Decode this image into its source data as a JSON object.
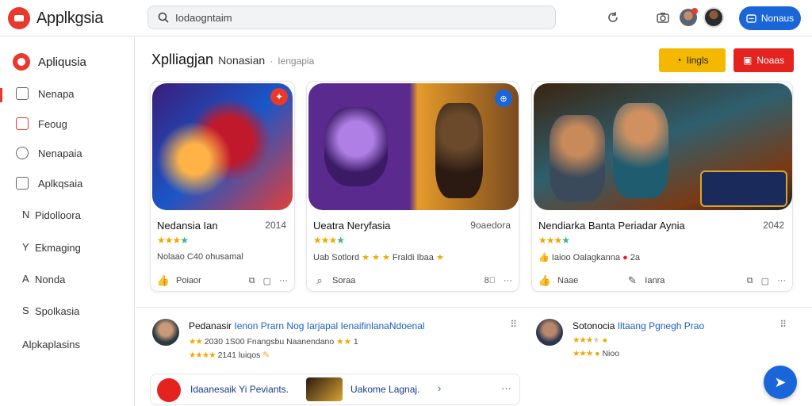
{
  "app": {
    "name": "Applkgsia"
  },
  "search": {
    "value": "Iodaogntaim",
    "icon": "search-icon"
  },
  "top_actions": {
    "signin_label": "Nonaus"
  },
  "sidebar": {
    "header": "Apliqusia",
    "items": [
      {
        "label": "Nenapa",
        "icon": "home-icon"
      },
      {
        "label": "Feoug",
        "icon": "bookmark-icon"
      },
      {
        "label": "Nenapaia",
        "icon": "chat-icon"
      },
      {
        "label": "Aplkqsaia",
        "icon": "grid-icon"
      },
      {
        "label": "Pidolloora",
        "prefix": "N"
      },
      {
        "label": "Ekmaging",
        "prefix": "Y"
      },
      {
        "label": "Nonda",
        "prefix": "A"
      },
      {
        "label": "Spolkasia",
        "prefix": "S"
      },
      {
        "label": "Alpkaplasins",
        "prefix": ""
      }
    ]
  },
  "header": {
    "title": "Xplliagjan",
    "subtitle": "Nonasian",
    "sep": "·",
    "crumb": "Iengapia",
    "btn_yellow": "Iingls",
    "btn_red": "Noaas"
  },
  "cards": [
    {
      "title": "Nedansia Ian",
      "meta": "2014",
      "info": "Nolaao C40 ohusamal",
      "action": "Poiaor"
    },
    {
      "title": "Ueatra Neryfasia",
      "meta": "9oaedora",
      "info": "Uab Sotlord",
      "info_extra": "Fraldi Ibaa",
      "action": "Soraa"
    },
    {
      "title": "Nendiarka Banta Periadar Aynia",
      "meta": "2042",
      "info": "Iaioo Oalagkanna",
      "info_extra": "2a",
      "action": "Naae",
      "action2": "Ianra"
    }
  ],
  "list": [
    {
      "title_a": "Pedanasir",
      "title_b": "Ienon Prarn Nog Iarjapal IenaifinlanaNdoenal",
      "line1": "2030 1S00 Fnangsbu Naanendano",
      "line1_extra": "1",
      "line2": "2141 luiqos"
    },
    {
      "title_a": "Sotonocia",
      "title_b": "Iltaang Pgnegh Prao",
      "line1": "",
      "line2": "Nioo"
    },
    {
      "title_a": "Idaanesaik Yi Peviants.",
      "title_b": "Uakome Lagnaj.",
      "line1": ""
    }
  ],
  "colors": {
    "accent_red": "#e8392c",
    "accent_blue": "#1a66d9",
    "yellow": "#f5b800"
  }
}
